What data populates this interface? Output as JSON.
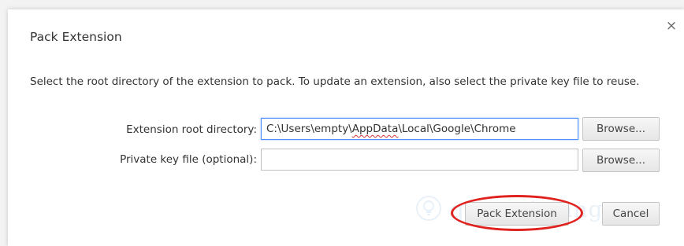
{
  "dialog": {
    "title": "Pack Extension",
    "description": "Select the root directory of the extension to pack. To update an extension, also select the private key file to reuse.",
    "close_glyph": "×"
  },
  "form": {
    "root_label": "Extension root directory:",
    "root_value_prefix": "C:\\Users\\empty\\",
    "root_value_mark": "AppData",
    "root_value_suffix": "\\Local\\Google\\Chrome",
    "key_label": "Private key file (optional):",
    "key_value": "",
    "browse_label": "Browse..."
  },
  "actions": {
    "pack_label": "Pack Extension",
    "cancel_label": "Cancel"
  },
  "watermark": {
    "text": "quantrimang"
  },
  "colors": {
    "focus_border": "#4d90fe",
    "highlight": "#e0221f"
  }
}
